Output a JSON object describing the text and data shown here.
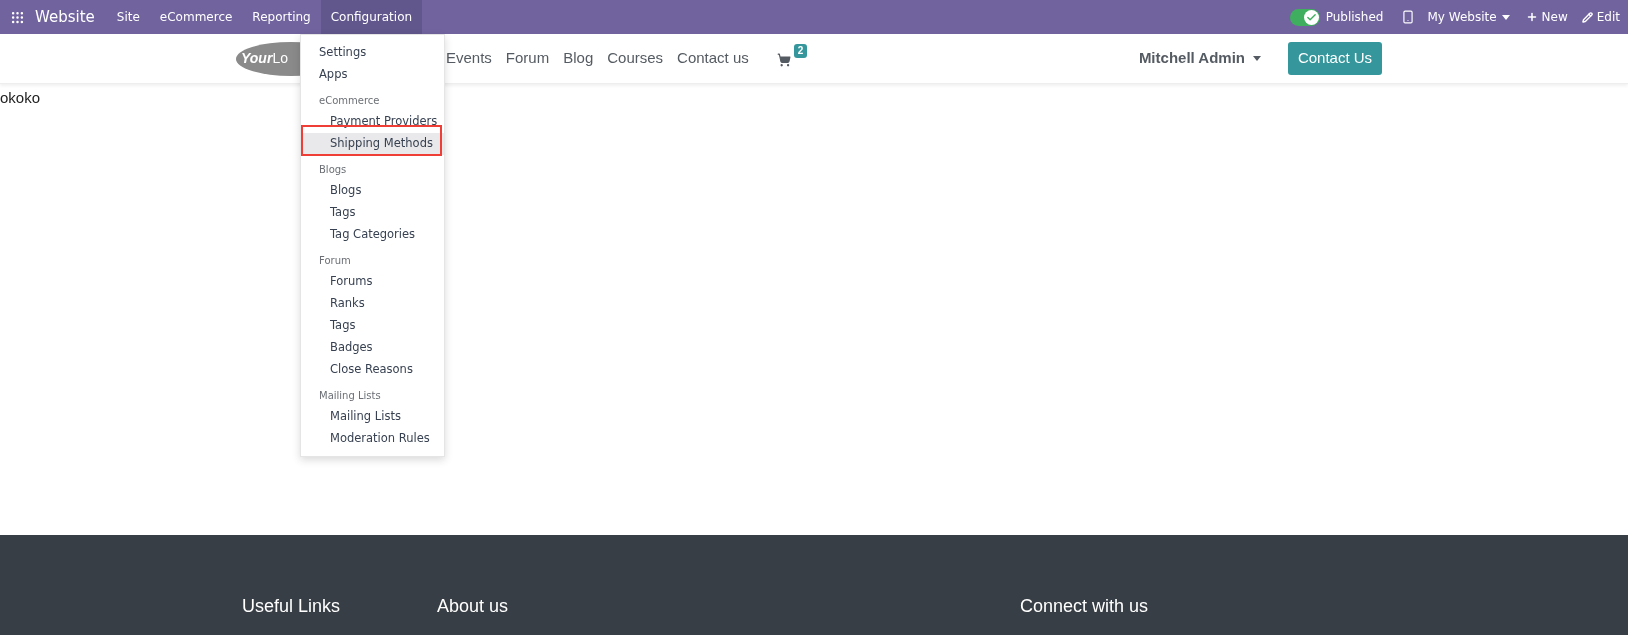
{
  "top_bar": {
    "app_name": "Website",
    "menus": [
      {
        "label": "Site",
        "selected": false
      },
      {
        "label": "eCommerce",
        "selected": false
      },
      {
        "label": "Reporting",
        "selected": false
      },
      {
        "label": "Configuration",
        "selected": true
      }
    ],
    "published": {
      "on": true,
      "label": "Published"
    },
    "website_switcher": "My Website",
    "new_button": "New",
    "edit_button": "Edit"
  },
  "dropdown": [
    {
      "kind": "item",
      "label": "Settings",
      "selected": false
    },
    {
      "kind": "item",
      "label": "Apps",
      "selected": false
    },
    {
      "kind": "header",
      "label": "eCommerce"
    },
    {
      "kind": "subitem",
      "label": "Payment Providers",
      "selected": false
    },
    {
      "kind": "subitem",
      "label": "Shipping Methods",
      "selected": true,
      "annotated": true
    },
    {
      "kind": "header",
      "label": "Blogs"
    },
    {
      "kind": "subitem",
      "label": "Blogs",
      "selected": false
    },
    {
      "kind": "subitem",
      "label": "Tags",
      "selected": false
    },
    {
      "kind": "subitem",
      "label": "Tag Categories",
      "selected": false
    },
    {
      "kind": "header",
      "label": "Forum"
    },
    {
      "kind": "subitem",
      "label": "Forums",
      "selected": false
    },
    {
      "kind": "subitem",
      "label": "Ranks",
      "selected": false
    },
    {
      "kind": "subitem",
      "label": "Tags",
      "selected": false
    },
    {
      "kind": "subitem",
      "label": "Badges",
      "selected": false
    },
    {
      "kind": "subitem",
      "label": "Close Reasons",
      "selected": false
    },
    {
      "kind": "header",
      "label": "Mailing Lists"
    },
    {
      "kind": "subitem",
      "label": "Mailing Lists",
      "selected": false
    },
    {
      "kind": "subitem",
      "label": "Moderation Rules",
      "selected": false
    }
  ],
  "site_nav": {
    "logo": {
      "bold": "Your",
      "light": "Lo"
    },
    "links": [
      "Events",
      "Forum",
      "Blog",
      "Courses",
      "Contact us"
    ],
    "cart_count": "2",
    "user": "Mitchell Admin",
    "cta": "Contact Us"
  },
  "body_text": "okoko",
  "footer": {
    "headings": [
      "Useful Links",
      "About us",
      "Connect with us"
    ]
  }
}
